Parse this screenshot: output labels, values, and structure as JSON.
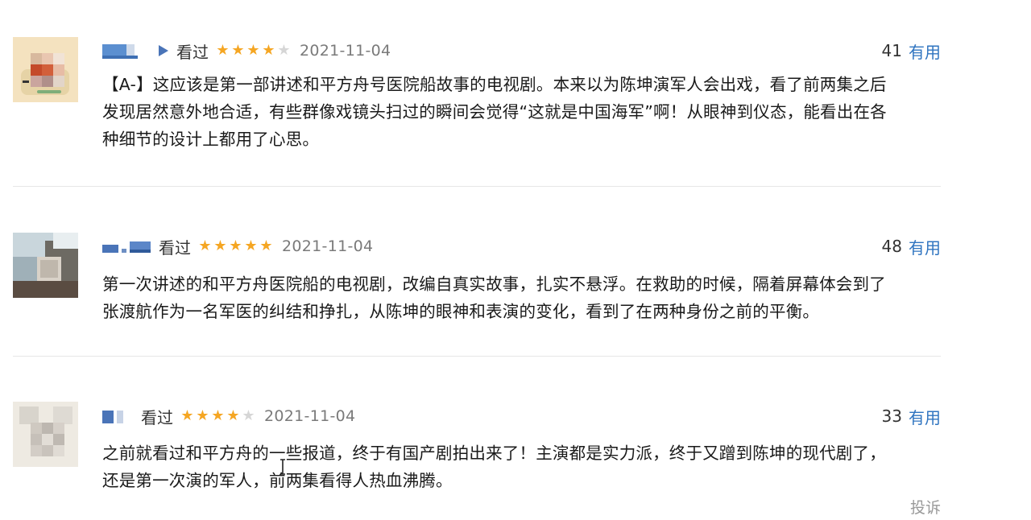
{
  "reviews": [
    {
      "status": "看过",
      "stars": [
        "on",
        "on",
        "on",
        "on",
        "off"
      ],
      "date": "2021-11-04",
      "useful_count": "41",
      "useful_label": "有用",
      "text": "【A-】这应该是第一部讲述和平方舟号医院船故事的电视剧。本来以为陈坤演军人会出戏，看了前两集之后\n发现居然意外地合适，有些群像戏镜头扫过的瞬间会觉得“这就是中国海军”啊！从眼神到仪态，能看出在各\n种细节的设计上都用了心思。"
    },
    {
      "status": "看过",
      "stars": [
        "on",
        "on",
        "on",
        "on",
        "on"
      ],
      "date": "2021-11-04",
      "useful_count": "48",
      "useful_label": "有用",
      "text": "第一次讲述的和平方舟医院船的电视剧，改编自真实故事，扎实不悬浮。在救助的时候，隔着屏幕体会到了\n张渡航作为一名军医的纠结和挣扎，从陈坤的眼神和表演的变化，看到了在两种身份之前的平衡。"
    },
    {
      "status": "看过",
      "stars": [
        "on",
        "on",
        "on",
        "on",
        "off"
      ],
      "date": "2021-11-04",
      "useful_count": "33",
      "useful_label": "有用",
      "text": "之前就看过和平方舟的一些报道，终于有国产剧拍出来了！主演都是实力派，终于又蹭到陈坤的现代剧了，\n还是第一次演的军人，前两集看得人热血沸腾。"
    }
  ],
  "report_label": "投诉",
  "colors": {
    "star": "#f5a623",
    "star_off": "#d6d6d6",
    "link": "#2f74c0",
    "date": "#7a7a7a"
  }
}
